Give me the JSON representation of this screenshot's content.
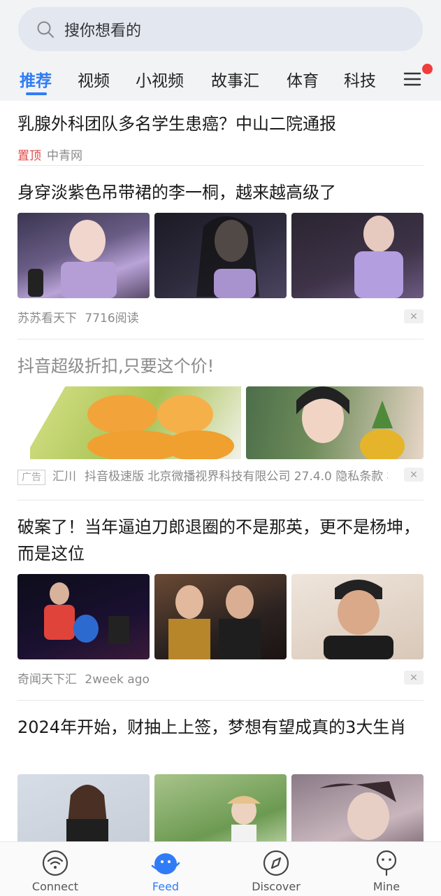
{
  "search": {
    "placeholder": "搜你想看的"
  },
  "tabs": [
    {
      "label": "推荐",
      "active": true
    },
    {
      "label": "视频"
    },
    {
      "label": "小视频"
    },
    {
      "label": "故事汇"
    },
    {
      "label": "体育"
    },
    {
      "label": "科技"
    }
  ],
  "feed": {
    "item1": {
      "title": "乳腺外科团队多名学生患癌？中山二院通报",
      "pin": "置顶",
      "source": "中青网"
    },
    "item2": {
      "title": "身穿淡紫色吊带裙的李一桐，越来越高级了",
      "source": "苏苏看天下",
      "reads": "7716阅读",
      "close": "×"
    },
    "item3": {
      "title": "抖音超级折扣,只要这个价!",
      "ad_tag": "广告",
      "advertiser": "汇川",
      "details": "抖音极速版 北京微播视界科技有限公司 27.4.0 隐私条款 杉",
      "close": "×"
    },
    "item4": {
      "title": "破案了！当年逼迫刀郎退圈的不是那英，更不是杨坤，而是这位",
      "source": "奇闻天下汇",
      "time": "2week ago",
      "close": "×"
    },
    "item5": {
      "title": "2024年开始，财抽上上签，梦想有望成真的3大生肖"
    }
  },
  "bottom_nav": [
    {
      "label": "Connect",
      "icon": "wifi-icon"
    },
    {
      "label": "Feed",
      "icon": "feed-face-icon",
      "active": true
    },
    {
      "label": "Discover",
      "icon": "compass-icon"
    },
    {
      "label": "Mine",
      "icon": "person-icon"
    }
  ],
  "colors": {
    "accent": "#2f7cf6",
    "pin": "#e0494a",
    "badge": "#f23b3b"
  }
}
